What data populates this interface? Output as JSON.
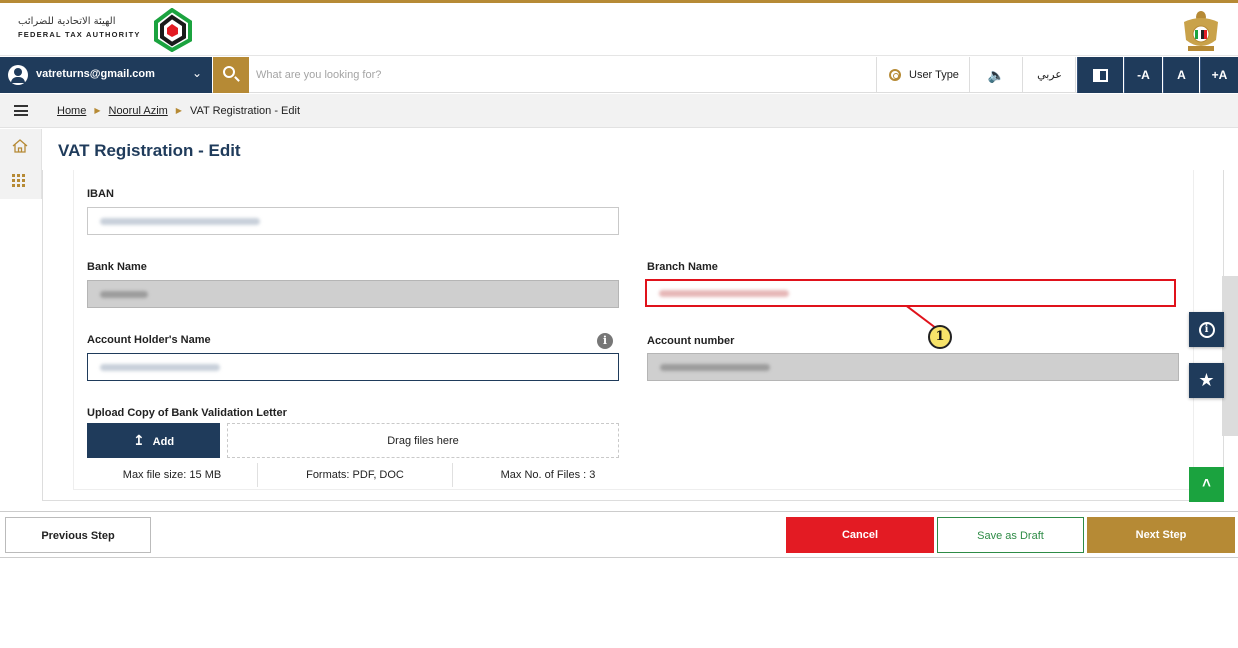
{
  "header": {
    "logo_arabic": "الهيئة الاتحادية للضرائب",
    "logo_english": "FEDERAL TAX AUTHORITY"
  },
  "navbar": {
    "user_email": "vatreturns@gmail.com",
    "search_placeholder": "What are you looking for?",
    "user_type_label": "User Type",
    "language_label": "عربي",
    "font_decrease": "-A",
    "font_default": "A",
    "font_increase": "+A"
  },
  "breadcrumb": {
    "home": "Home",
    "profile": "Noorul Azim",
    "current": "VAT Registration - Edit"
  },
  "page": {
    "title": "VAT Registration - Edit"
  },
  "form": {
    "iban_label": "IBAN",
    "bank_name_label": "Bank Name",
    "branch_name_label": "Branch Name",
    "account_holder_label": "Account Holder's Name",
    "account_number_label": "Account number",
    "upload_label": "Upload Copy of Bank Validation Letter",
    "add_button": "Add",
    "dropzone_text": "Drag files here",
    "max_size": "Max file size: 15 MB",
    "formats": "Formats: PDF, DOC",
    "max_files": "Max No. of Files : 3"
  },
  "callout": {
    "number": "1"
  },
  "footer": {
    "previous": "Previous Step",
    "cancel": "Cancel",
    "save_draft": "Save as Draft",
    "next": "Next Step"
  },
  "colors": {
    "brand_navy": "#1f3b5b",
    "brand_gold": "#b68a35",
    "cancel_red": "#e31b23",
    "highlight_red": "#e0121b",
    "draft_green": "#2e8b46",
    "scroll_green": "#1ba33f"
  },
  "icons": [
    "user-avatar-icon",
    "chevron-down-icon",
    "search-icon",
    "gear-icon",
    "speaker-icon",
    "contrast-icon",
    "menu-icon",
    "home-icon",
    "apps-grid-icon",
    "info-icon",
    "star-icon",
    "upload-icon",
    "double-chevron-up-icon"
  ]
}
